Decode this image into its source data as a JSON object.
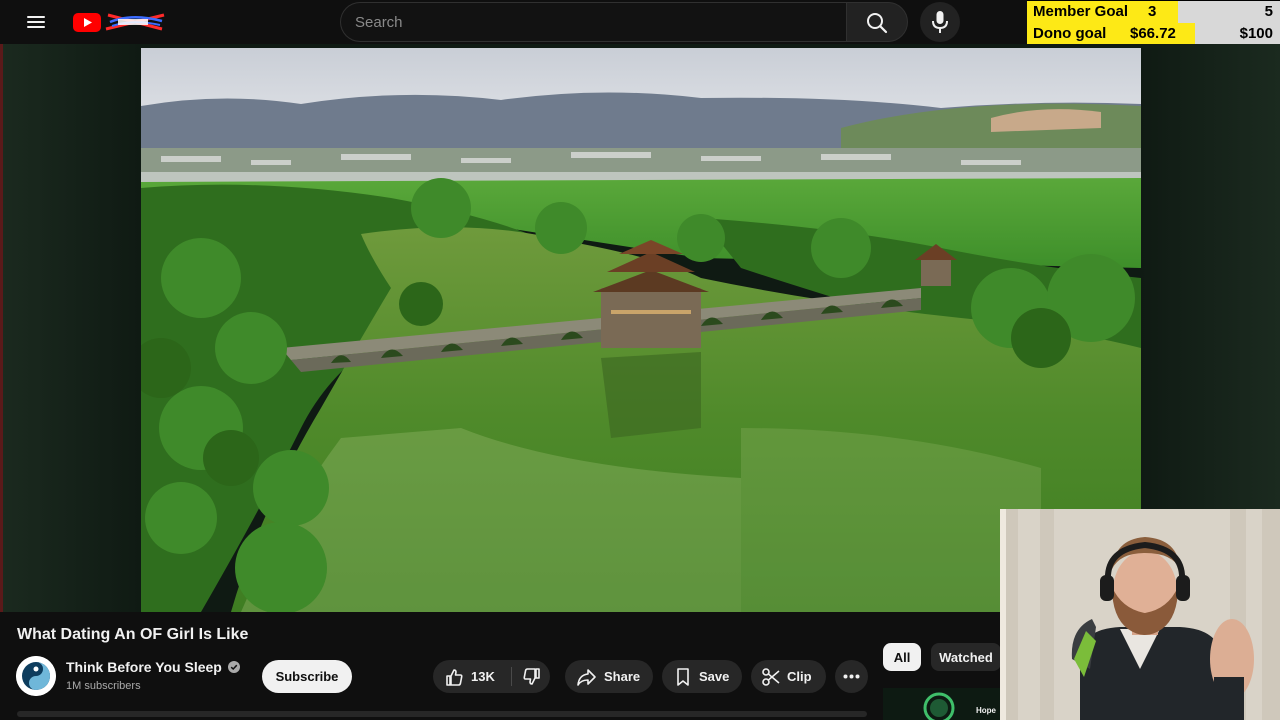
{
  "header": {
    "search_placeholder": "Search",
    "icons": {
      "menu": "hamburger-menu-icon",
      "logo": "youtube-logo",
      "search": "search-icon",
      "mic": "microphone-icon"
    }
  },
  "goals": {
    "member": {
      "label": "Member Goal",
      "current": "3",
      "target": "5",
      "progress": 0.6
    },
    "dono": {
      "label": "Dono goal",
      "current": "$66.72",
      "target": "$100",
      "progress": 0.667
    },
    "colors": {
      "fill": "#fde916",
      "rest": "#d8d8d8"
    }
  },
  "video": {
    "title": "What Dating An OF Girl Is Like",
    "channel": {
      "name": "Think Before You Sleep",
      "subscribers": "1M subscribers",
      "verified": true
    },
    "subscribe_label": "Subscribe",
    "actions": {
      "likes": "13K",
      "share": "Share",
      "save": "Save",
      "clip": "Clip"
    }
  },
  "sidebar": {
    "chips": [
      "All",
      "Watched"
    ],
    "selected_chip": "All",
    "thumb_caption": "Hope"
  },
  "colors": {
    "background": "#0f0f0f",
    "brand_red": "#ff0000",
    "pill": "#272727"
  }
}
